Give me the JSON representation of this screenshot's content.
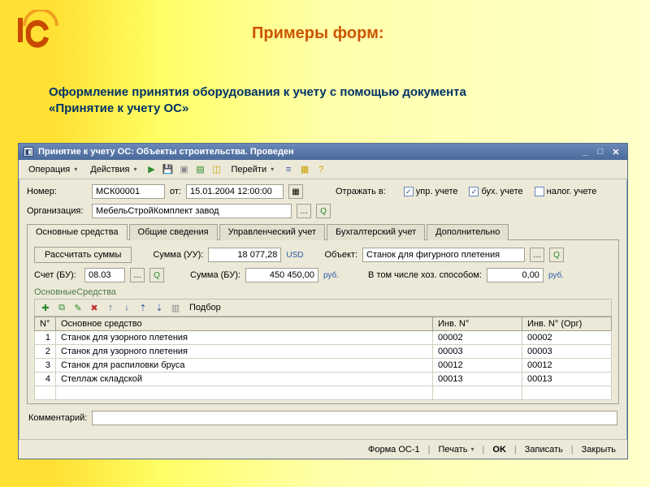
{
  "slide": {
    "title": "Примеры форм:",
    "subtitle": "Оформление принятия оборудования к учету с помощью документа «Принятие к учету ОС»"
  },
  "window": {
    "title": "Принятие к учету ОС: Объекты строительства. Проведен",
    "toolbar": {
      "operation": "Операция",
      "actions": "Действия",
      "go": "Перейти"
    },
    "labels": {
      "number": "Номер:",
      "date": "от:",
      "reflect": "Отражать в:",
      "org": "Организация:",
      "chk_mgmt": "упр. учете",
      "chk_acc": "бух. учете",
      "chk_tax": "налог. учете",
      "comment": "Комментарий:"
    },
    "values": {
      "number": "МСК00001",
      "date": "15.01.2004 12:00:00",
      "org": "МебельСтройКомплект завод",
      "chk_mgmt": true,
      "chk_acc": true,
      "chk_tax": false,
      "comment": ""
    },
    "tabs": [
      "Основные средства",
      "Общие сведения",
      "Управленческий учет",
      "Бухгалтерский учет",
      "Дополнительно"
    ],
    "panel": {
      "btn_calc": "Рассчитать суммы",
      "lbl_sum_uu": "Сумма (УУ):",
      "sum_uu": "18 077,28",
      "currency_uu": "USD",
      "lbl_object": "Объект:",
      "object": "Станок для фигурного плетения",
      "lbl_account": "Счет (БУ):",
      "account": "08.03",
      "lbl_sum_bu": "Сумма (БУ):",
      "sum_bu": "450 450,00",
      "currency_bu": "руб.",
      "lbl_incl": "В том числе хоз. способом:",
      "incl": "0,00",
      "currency_incl": "руб.",
      "subheader": "ОсновныеСредства",
      "grid_toolbar_pick": "Подбор",
      "columns": [
        "N°",
        "Основное средство",
        "Инв. N°",
        "Инв. N° (Орг)"
      ],
      "rows": [
        {
          "n": "1",
          "name": "Станок для узорного плетения",
          "inv": "00002",
          "inv_org": "00002"
        },
        {
          "n": "2",
          "name": "Станок для узорного плетения",
          "inv": "00003",
          "inv_org": "00003"
        },
        {
          "n": "3",
          "name": "Станок для распиловки бруса",
          "inv": "00012",
          "inv_org": "00012"
        },
        {
          "n": "4",
          "name": "Стеллаж складской",
          "inv": "00013",
          "inv_org": "00013"
        }
      ]
    },
    "footer": {
      "form": "Форма ОС-1",
      "print": "Печать",
      "ok": "OK",
      "save": "Записать",
      "close": "Закрыть"
    }
  }
}
